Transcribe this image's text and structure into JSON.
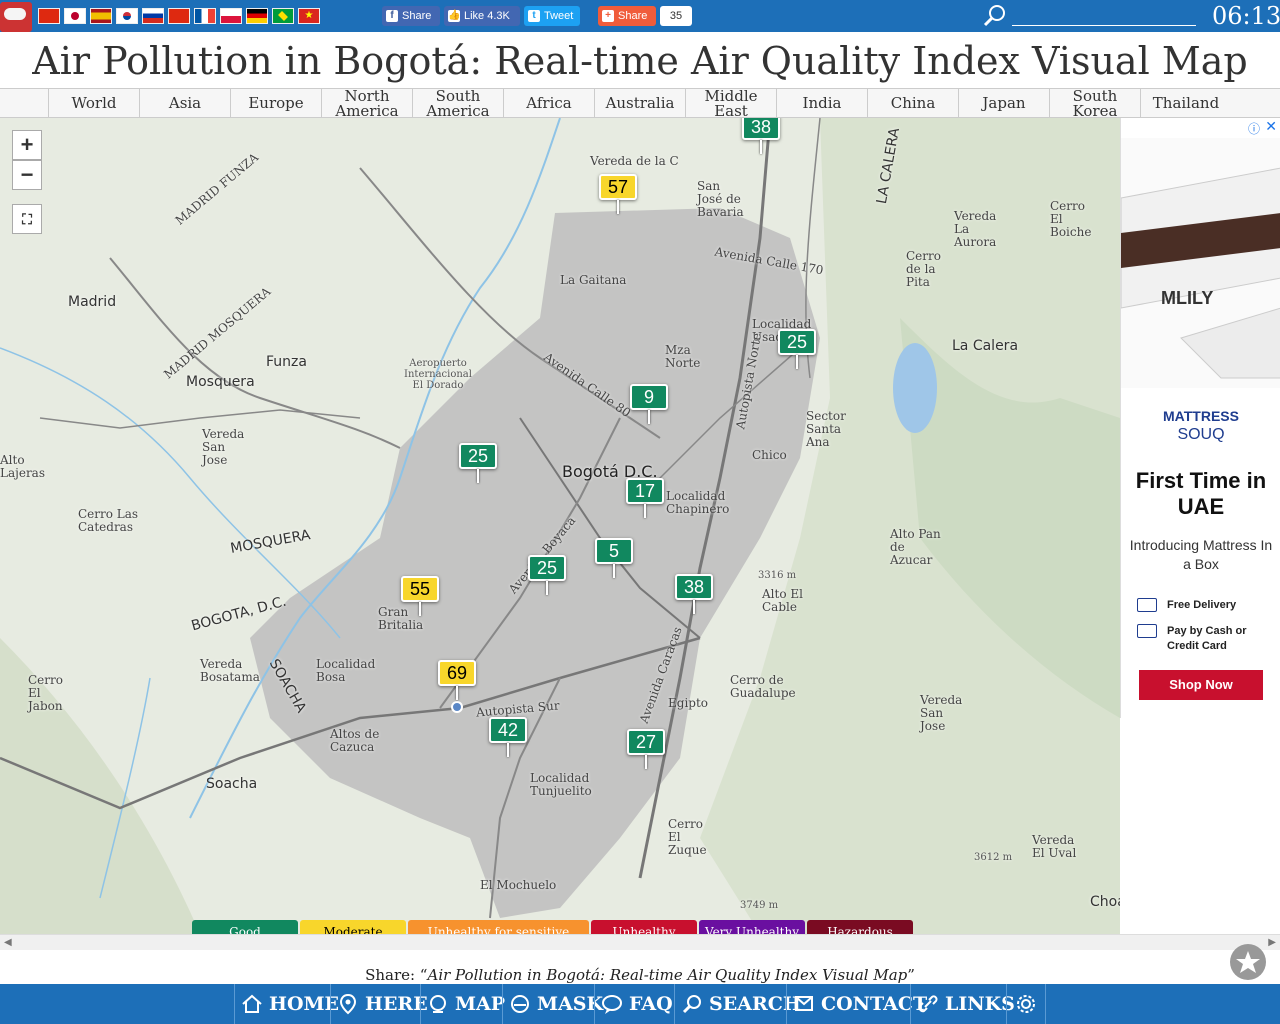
{
  "header": {
    "clock": "06:13",
    "share_fb": "Share",
    "like_label": "Like",
    "like_count": "4.3K",
    "tweet_label": "Tweet",
    "share_label": "Share",
    "share_count": "35",
    "flags": [
      "china",
      "japan",
      "spain",
      "korea",
      "russia",
      "hongkong",
      "france",
      "poland",
      "germany",
      "brazil",
      "vietnam"
    ]
  },
  "title": "Air Pollution in Bogotá: Real-time Air Quality Index Visual Map",
  "regions": [
    "World",
    "Asia",
    "Europe",
    "North America",
    "South America",
    "Africa",
    "Australia",
    "Middle East",
    "India",
    "China",
    "Japan",
    "South Korea",
    "Thailand"
  ],
  "map": {
    "stations": [
      {
        "value": "38",
        "level": "good"
      },
      {
        "value": "57",
        "level": "moderate"
      },
      {
        "value": "25",
        "level": "good"
      },
      {
        "value": "9",
        "level": "good"
      },
      {
        "value": "25",
        "level": "good"
      },
      {
        "value": "17",
        "level": "good"
      },
      {
        "value": "5",
        "level": "good"
      },
      {
        "value": "25",
        "level": "good"
      },
      {
        "value": "38",
        "level": "good"
      },
      {
        "value": "55",
        "level": "moderate"
      },
      {
        "value": "69",
        "level": "moderate"
      },
      {
        "value": "42",
        "level": "good"
      },
      {
        "value": "27",
        "level": "good"
      }
    ],
    "labels": {
      "vereda_dela_c": "Vereda de la C",
      "san_jose_bavaria": "San José de Bavaria",
      "madrid_funza": "MADRID FUNZA",
      "madrid": "Madrid",
      "madrid_mosquera": "MADRID MOSQUERA",
      "funza": "Funza",
      "mosquera": "Mosquera",
      "aeropuerto": "Aeropuerto Internacional El Dorado",
      "la_gaitana": "La Gaitana",
      "mza_norte": "Mza Norte",
      "localidad_usaquen": "Localidad Usaquén",
      "bogota_dc": "Bogotá D.C.",
      "localidad_chapinero": "Localidad Chapinero",
      "chico": "Chico",
      "sector_santa_ana": "Sector Santa Ana",
      "vereda_san_jose": "Vereda San Jose",
      "alto_lajeras": "Alto Lajeras",
      "cerro_las_catedras": "Cerro Las Catedras",
      "mosquera_dept": "MOSQUERA",
      "bogota_dc_region": "BOGOTA, D.C.",
      "gran_britalia": "Gran Britalia",
      "localidad_bosa": "Localidad Bosa",
      "vereda_bosatama": "Vereda Bosatama",
      "soacha_region": "SOACHA",
      "cerro_el_jabon": "Cerro El Jabon",
      "soacha": "Soacha",
      "altos_de_cazuca": "Altos de Cazuca",
      "localidad_tunjuelito": "Localidad Tunjuelito",
      "el_mochuelo": "El Mochuelo",
      "cerro_el_zuque": "Cerro El Zuque",
      "egipto": "Egipto",
      "cerro_guadalupe": "Cerro de Guadalupe",
      "alto_el_cable": "Alto El Cable",
      "alto_pan_azucar": "Alto Pan de Azucar",
      "vereda_san_jose_east": "Vereda San Jose",
      "la_calera": "La Calera",
      "cerro_la_pita": "Cerro de la Pita",
      "vereda_la_aurora": "Vereda La Aurora",
      "cerro_el_boiche": "Cerro El Boiche",
      "vereda_el_uval": "Vereda El Uval",
      "choa": "Choa",
      "la_calera_region": "LA CALERA",
      "avenida_calle_80": "Avenida Calle 80",
      "avenida_calle_170": "Avenida Calle 170",
      "avenida_boyaca": "Avenida Boyaca",
      "autopista_sur": "Autopista Sur",
      "avenida_caracas": "Avenida Caracas",
      "autopista_norte": "Autopista Norte",
      "elev_3316": "3316 m",
      "elev_3612": "3612 m",
      "elev_3749": "3749 m"
    },
    "legend": [
      "Good",
      "Moderate",
      "Unhealthy for sensitive groups",
      "Unhealthy",
      "Very Unhealthy",
      "Hazardous"
    ],
    "legend_colors": [
      "#11885f",
      "#f8d62b",
      "#f7922e",
      "#c8102e",
      "#6a0fa0",
      "#7a0b22"
    ]
  },
  "ad": {
    "brand": "MATTRESS",
    "brand2": "SOUQ",
    "logo_text": "MLILY",
    "headline": "First Time in UAE",
    "sub": "Introducing Mattress In a Box",
    "features": [
      "Free Delivery",
      "Pay by Cash or Credit Card"
    ],
    "cta": "Shop Now"
  },
  "share": {
    "prefix": "Share: “",
    "title": "Air Pollution in Bogotá: Real-time Air Quality Index Visual Map",
    "suffix": "”"
  },
  "bottom_nav": [
    "HOME",
    "HERE",
    "MAP",
    "MASK",
    "FAQ",
    "SEARCH",
    "CONTACT",
    "LINKS"
  ]
}
